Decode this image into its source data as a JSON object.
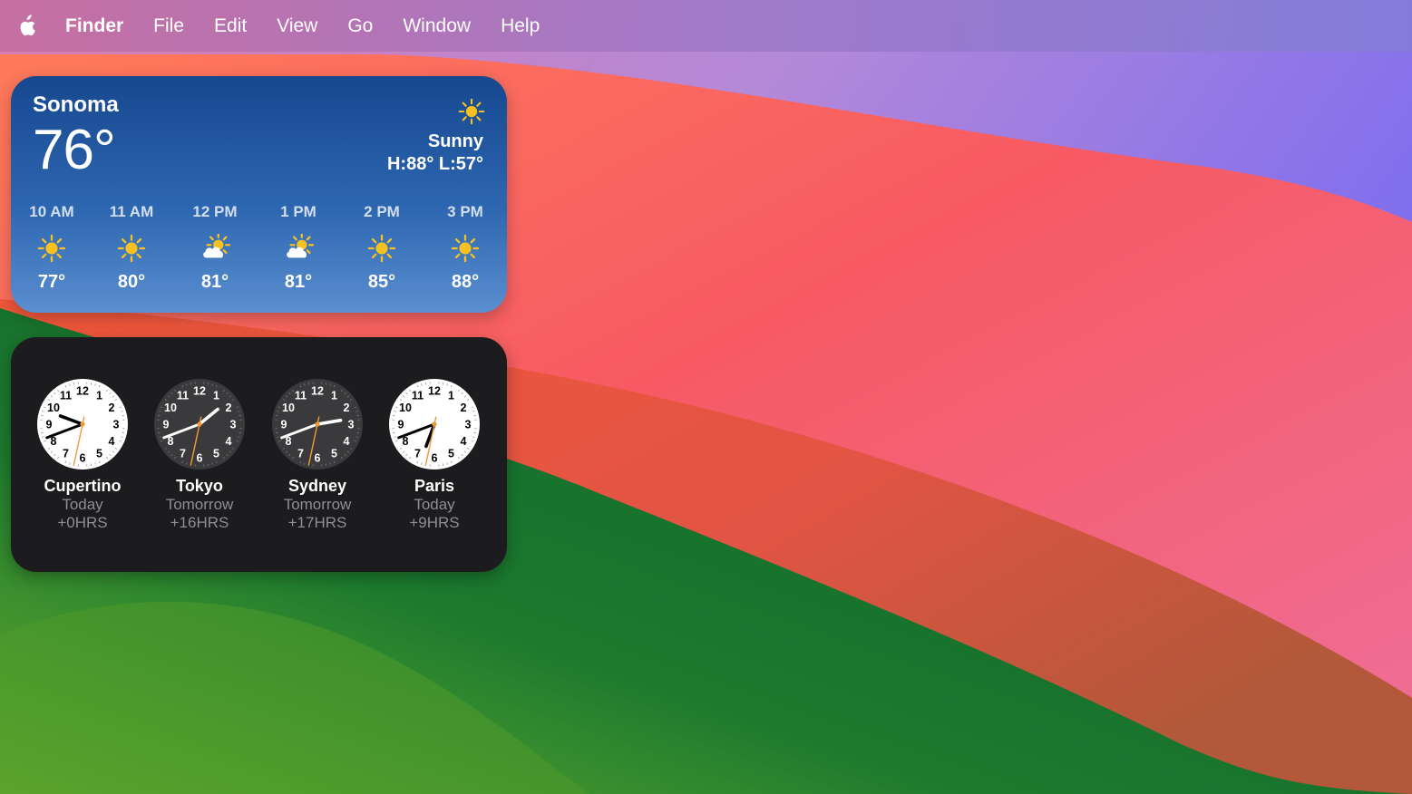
{
  "menubar": {
    "apple_icon": "apple-logo-icon",
    "items": [
      "Finder",
      "File",
      "Edit",
      "View",
      "Go",
      "Window",
      "Help"
    ]
  },
  "weather": {
    "city": "Sonoma",
    "temperature": "76°",
    "condition": "Sunny",
    "condition_icon": "sun-icon",
    "hi_lo": "H:88° L:57°",
    "hourly": [
      {
        "time": "10 AM",
        "icon": "sun-icon",
        "temp": "77°"
      },
      {
        "time": "11 AM",
        "icon": "sun-icon",
        "temp": "80°"
      },
      {
        "time": "12 PM",
        "icon": "partly-cloudy-icon",
        "temp": "81°"
      },
      {
        "time": "1 PM",
        "icon": "partly-cloudy-icon",
        "temp": "81°"
      },
      {
        "time": "2 PM",
        "icon": "sun-icon",
        "temp": "85°"
      },
      {
        "time": "3 PM",
        "icon": "sun-icon",
        "temp": "88°"
      }
    ]
  },
  "world_clock": {
    "clocks": [
      {
        "city": "Cupertino",
        "day": "Today",
        "offset": "+0HRS",
        "theme": "light",
        "hour": 9,
        "minute": 41,
        "second": 32
      },
      {
        "city": "Tokyo",
        "day": "Tomorrow",
        "offset": "+16HRS",
        "theme": "dark",
        "hour": 1,
        "minute": 41,
        "second": 32
      },
      {
        "city": "Sydney",
        "day": "Tomorrow",
        "offset": "+17HRS",
        "theme": "dark",
        "hour": 2,
        "minute": 41,
        "second": 32
      },
      {
        "city": "Paris",
        "day": "Today",
        "offset": "+9HRS",
        "theme": "light",
        "hour": 6,
        "minute": 41,
        "second": 32
      }
    ]
  },
  "colors": {
    "sun": "#f7c221",
    "second_hand": "#f09a37",
    "widget_dark": "#1c1c1e"
  }
}
